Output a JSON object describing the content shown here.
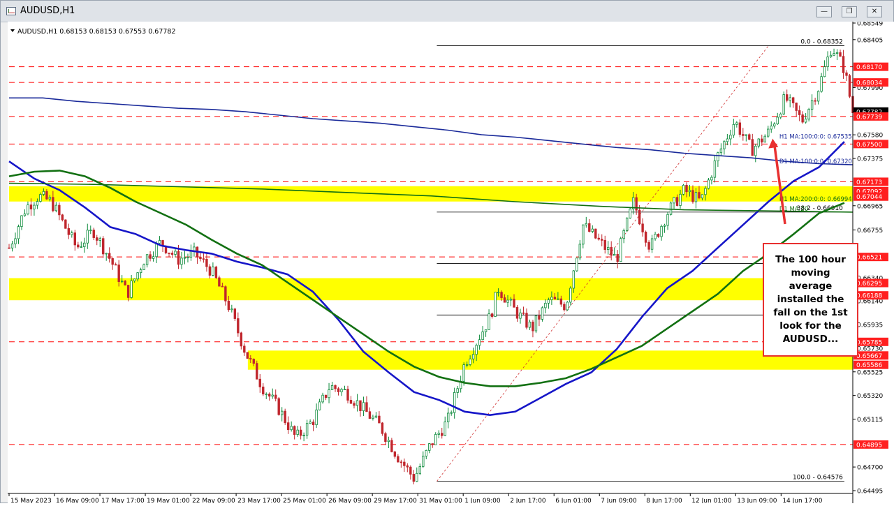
{
  "window": {
    "title": "AUDUSD,H1",
    "controls": [
      "minimize",
      "restore",
      "close"
    ]
  },
  "header": {
    "symbol_line": "AUDUSD,H1  0.68153 0.68153 0.67553 0.67782"
  },
  "annotation": {
    "callout_text": "The 100 hour moving average installed the fall on the 1st look for the AUDUSD..."
  },
  "colors": {
    "background": "#ffffff",
    "bull_candle": "#0b8a3a",
    "bear_candle": "#c0262d",
    "ma_hourly_100": "#1616c8",
    "ma_hourly_200": "#127012",
    "ma_daily": "#1a2a9a",
    "support_zone": "#ffff00",
    "resistance_line": "#ff0000",
    "callout_border": "#e83030",
    "fib_line": "#000000"
  },
  "chart_data": {
    "type": "candlestick",
    "timeframe": "H1",
    "ylim": [
      0.64495,
      0.68549
    ],
    "x_ticks": [
      "15 May 2023",
      "16 May 09:00",
      "17 May 17:00",
      "19 May 01:00",
      "22 May 09:00",
      "23 May 17:00",
      "25 May 01:00",
      "26 May 09:00",
      "29 May 17:00",
      "31 May 01:00",
      "1 Jun 09:00",
      "2 Jun 17:00",
      "6 Jun 01:00",
      "7 Jun 09:00",
      "8 Jun 17:00",
      "12 Jun 01:00",
      "13 Jun 09:00",
      "14 Jun 17:00"
    ],
    "y_ticks": [
      "0.68549",
      "0.68405",
      "0.67990",
      "0.67782",
      "0.67580",
      "0.67375",
      "0.66965",
      "0.66755",
      "0.66340",
      "0.66140",
      "0.65935",
      "0.65730",
      "0.65525",
      "0.65320",
      "0.65115",
      "0.64700",
      "0.64495"
    ],
    "price_tags": [
      {
        "label": "0.68170",
        "value": 0.6817,
        "style": "red"
      },
      {
        "label": "0.68034",
        "value": 0.68034,
        "style": "red"
      },
      {
        "label": "0.67782",
        "value": 0.67782,
        "style": "current"
      },
      {
        "label": "0.67739",
        "value": 0.67739,
        "style": "red"
      },
      {
        "label": "0.67500",
        "value": 0.675,
        "style": "red"
      },
      {
        "label": "0.67173",
        "value": 0.67173,
        "style": "red"
      },
      {
        "label": "0.67092",
        "value": 0.67092,
        "style": "red"
      },
      {
        "label": "0.67044",
        "value": 0.67044,
        "style": "red"
      },
      {
        "label": "0.66521",
        "value": 0.66521,
        "style": "red"
      },
      {
        "label": "0.66295",
        "value": 0.66295,
        "style": "red"
      },
      {
        "label": "0.66188",
        "value": 0.66188,
        "style": "red"
      },
      {
        "label": "0.65785",
        "value": 0.65785,
        "style": "red"
      },
      {
        "label": "0.65667",
        "value": 0.65667,
        "style": "red"
      },
      {
        "label": "0.65586",
        "value": 0.65586,
        "style": "red"
      },
      {
        "label": "0.64895",
        "value": 0.64895,
        "style": "red"
      }
    ],
    "support_zones": [
      {
        "low": 0.67044,
        "high": 0.67092,
        "from_x": 0.0
      },
      {
        "low": 0.66188,
        "high": 0.66295,
        "from_x": 0.0
      },
      {
        "low": 0.65586,
        "high": 0.65667,
        "from_x": 0.283
      }
    ],
    "red_dashed_levels": [
      0.6817,
      0.68034,
      0.67739,
      0.675,
      0.67173,
      0.66521,
      0.65785,
      0.64895
    ],
    "fibonacci": {
      "high": 0.68352,
      "low": 0.64576,
      "levels": [
        {
          "label": "0.0 - 0.68352",
          "value": 0.68352
        },
        {
          "label": "38.2 - 0.66910",
          "value": 0.6691
        },
        {
          "label": "",
          "value": 0.66464
        },
        {
          "label": "",
          "value": 0.66018
        },
        {
          "label": "100.0 - 0.64576",
          "value": 0.64576
        }
      ]
    },
    "indicator_labels": [
      {
        "label": "H1 MA:100:0:0: 0.67535",
        "value": 0.67535
      },
      {
        "label": "D1 MA:100:0:0: 0.67320",
        "value": 0.6732
      },
      {
        "label": "H1 MA:200:0:0: 0.66994",
        "value": 0.66994
      },
      {
        "label": "D1 MA:20",
        "value": 0.6691
      }
    ],
    "series": [
      {
        "name": "H1 MA:100",
        "x": [
          0.0,
          0.03,
          0.06,
          0.09,
          0.12,
          0.15,
          0.18,
          0.21,
          0.24,
          0.27,
          0.3,
          0.33,
          0.36,
          0.39,
          0.42,
          0.45,
          0.48,
          0.51,
          0.54,
          0.57,
          0.6,
          0.63,
          0.66,
          0.69,
          0.72,
          0.75,
          0.78,
          0.81,
          0.84,
          0.87,
          0.9,
          0.93,
          0.96,
          0.99
        ],
        "values": [
          0.6735,
          0.672,
          0.671,
          0.6695,
          0.6678,
          0.6672,
          0.6662,
          0.6658,
          0.6655,
          0.6648,
          0.6643,
          0.6637,
          0.6622,
          0.6598,
          0.657,
          0.6552,
          0.6535,
          0.6528,
          0.6518,
          0.6515,
          0.6518,
          0.653,
          0.6542,
          0.6552,
          0.6572,
          0.66,
          0.6625,
          0.664,
          0.666,
          0.668,
          0.67,
          0.6718,
          0.673,
          0.6752
        ]
      },
      {
        "name": "H1 MA:200",
        "x": [
          0.0,
          0.03,
          0.06,
          0.09,
          0.12,
          0.15,
          0.18,
          0.21,
          0.24,
          0.27,
          0.3,
          0.33,
          0.36,
          0.39,
          0.42,
          0.45,
          0.48,
          0.51,
          0.54,
          0.57,
          0.6,
          0.63,
          0.66,
          0.69,
          0.72,
          0.75,
          0.78,
          0.81,
          0.84,
          0.87,
          0.9,
          0.93,
          0.96,
          0.99
        ],
        "values": [
          0.6722,
          0.6726,
          0.6727,
          0.6722,
          0.6712,
          0.67,
          0.669,
          0.668,
          0.6667,
          0.6655,
          0.6645,
          0.663,
          0.6615,
          0.66,
          0.6585,
          0.657,
          0.6557,
          0.6548,
          0.6543,
          0.654,
          0.654,
          0.6543,
          0.6547,
          0.6555,
          0.6565,
          0.6575,
          0.659,
          0.6605,
          0.662,
          0.664,
          0.6655,
          0.6672,
          0.669,
          0.6699
        ]
      },
      {
        "name": "D1 MA:100",
        "x": [
          0.0,
          0.04,
          0.08,
          0.12,
          0.16,
          0.2,
          0.24,
          0.28,
          0.32,
          0.36,
          0.4,
          0.44,
          0.48,
          0.52,
          0.56,
          0.6,
          0.64,
          0.68,
          0.72,
          0.76,
          0.8,
          0.84,
          0.88,
          0.92,
          0.96,
          1.0
        ],
        "values": [
          0.679,
          0.679,
          0.6787,
          0.6785,
          0.6783,
          0.6781,
          0.678,
          0.6778,
          0.6775,
          0.6772,
          0.677,
          0.6768,
          0.6765,
          0.6762,
          0.6758,
          0.6756,
          0.6753,
          0.675,
          0.6747,
          0.6745,
          0.6742,
          0.674,
          0.6738,
          0.6735,
          0.6733,
          0.6732
        ]
      },
      {
        "name": "D1 MA:200",
        "x": [
          0.0,
          0.1,
          0.2,
          0.3,
          0.4,
          0.5,
          0.6,
          0.7,
          0.8,
          0.9,
          1.0
        ],
        "values": [
          0.6716,
          0.6715,
          0.6713,
          0.6711,
          0.6708,
          0.6705,
          0.67,
          0.6696,
          0.6693,
          0.6692,
          0.6691
        ]
      }
    ],
    "price_path": {
      "x": [
        0.0,
        0.02,
        0.035,
        0.05,
        0.065,
        0.08,
        0.1,
        0.12,
        0.14,
        0.16,
        0.18,
        0.2,
        0.22,
        0.24,
        0.26,
        0.28,
        0.3,
        0.32,
        0.34,
        0.36,
        0.38,
        0.4,
        0.42,
        0.44,
        0.46,
        0.48,
        0.5,
        0.52,
        0.54,
        0.555,
        0.57,
        0.58,
        0.6,
        0.62,
        0.64,
        0.66,
        0.68,
        0.7,
        0.72,
        0.74,
        0.76,
        0.78,
        0.8,
        0.82,
        0.84,
        0.86,
        0.88,
        0.9,
        0.92,
        0.94,
        0.96,
        0.975,
        0.99,
        1.0
      ],
      "values": [
        0.666,
        0.6695,
        0.6705,
        0.67,
        0.668,
        0.666,
        0.6675,
        0.665,
        0.662,
        0.665,
        0.6665,
        0.665,
        0.6655,
        0.664,
        0.661,
        0.657,
        0.654,
        0.652,
        0.6495,
        0.651,
        0.654,
        0.6535,
        0.652,
        0.6505,
        0.648,
        0.646,
        0.649,
        0.651,
        0.656,
        0.658,
        0.66,
        0.6625,
        0.6605,
        0.659,
        0.6615,
        0.661,
        0.668,
        0.6665,
        0.665,
        0.67,
        0.666,
        0.669,
        0.671,
        0.67,
        0.674,
        0.677,
        0.6745,
        0.676,
        0.679,
        0.677,
        0.68,
        0.6835,
        0.6815,
        0.6778
      ]
    }
  }
}
